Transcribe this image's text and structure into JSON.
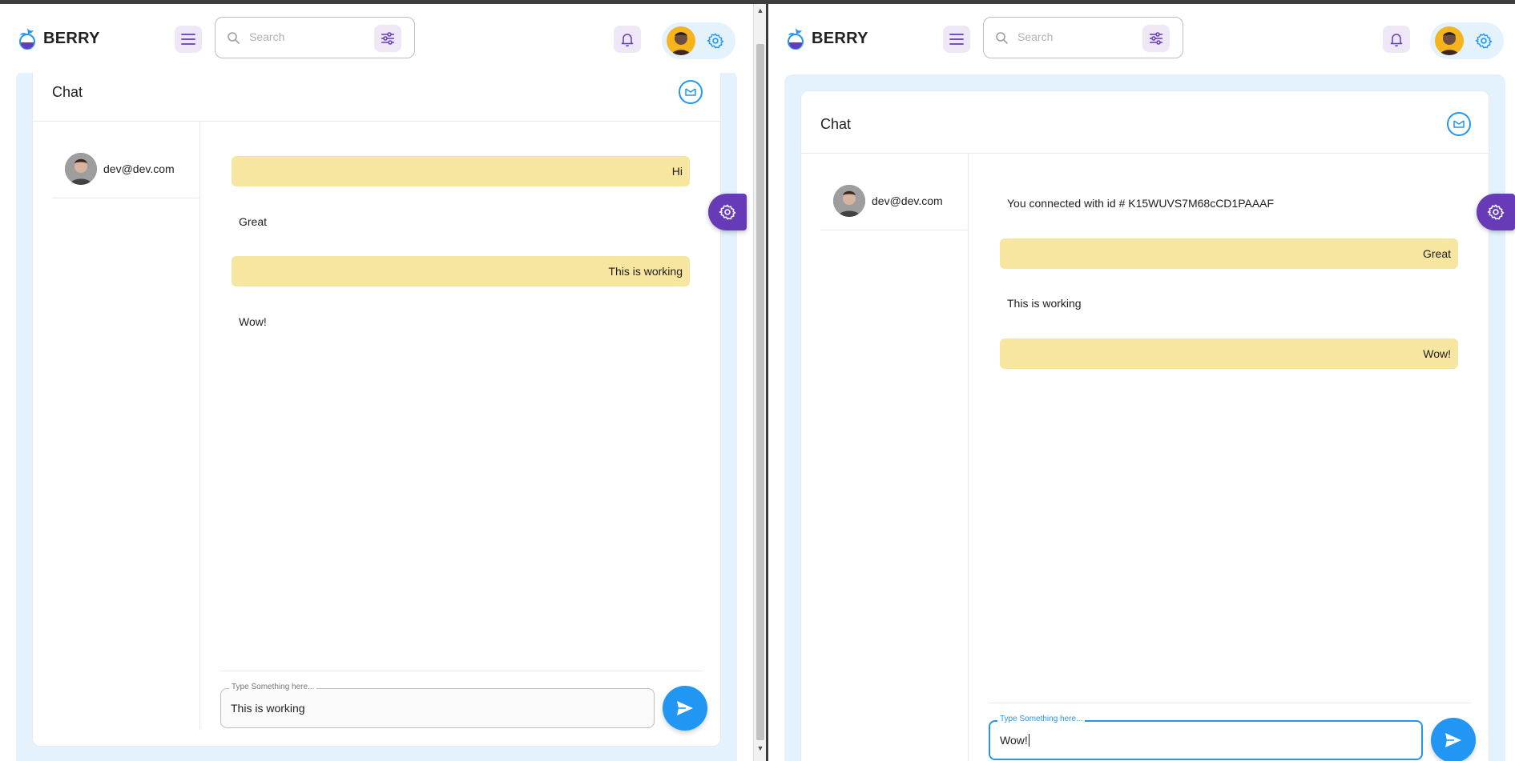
{
  "app": {
    "brand": "BERRY",
    "search_placeholder": "Search"
  },
  "left_window": {
    "card_title": "Chat",
    "contact_email": "dev@dev.com",
    "messages": [
      {
        "text": "Hi",
        "direction": "outgoing"
      },
      {
        "text": "Great",
        "direction": "incoming"
      },
      {
        "text": "This is working",
        "direction": "outgoing"
      },
      {
        "text": "Wow!",
        "direction": "incoming"
      }
    ],
    "input_label": "Type Something here...",
    "input_value": "This is working"
  },
  "right_window": {
    "card_title": "Chat",
    "contact_email": "dev@dev.com",
    "messages": [
      {
        "text": "You connected with id # K15WUVS7M68cCD1PAAAF",
        "direction": "incoming"
      },
      {
        "text": "Great",
        "direction": "outgoing"
      },
      {
        "text": "This is working",
        "direction": "incoming"
      },
      {
        "text": "Wow!",
        "direction": "outgoing"
      }
    ],
    "input_label": "Type Something here...",
    "input_value": "Wow!"
  },
  "colors": {
    "primary": "#2196f3",
    "secondary": "#673ab7",
    "outgoing_bubble": "#f6e6a0",
    "content_background": "#e3f2fd",
    "icon_button_bg": "#ede7f6"
  }
}
